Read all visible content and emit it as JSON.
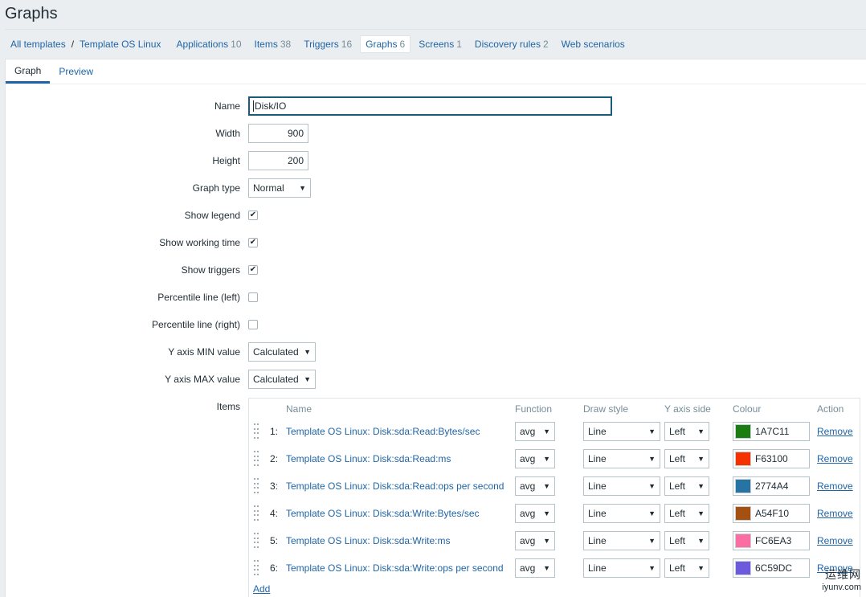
{
  "page": {
    "title": "Graphs"
  },
  "breadcrumbs": {
    "all_templates": "All templates",
    "separator": "/",
    "template": "Template OS Linux"
  },
  "tabs": [
    {
      "label": "Applications",
      "count": "10"
    },
    {
      "label": "Items",
      "count": "38"
    },
    {
      "label": "Triggers",
      "count": "16"
    },
    {
      "label": "Graphs",
      "count": "6",
      "active": true
    },
    {
      "label": "Screens",
      "count": "1"
    },
    {
      "label": "Discovery rules",
      "count": "2"
    },
    {
      "label": "Web scenarios",
      "count": ""
    }
  ],
  "subtabs": {
    "graph": "Graph",
    "preview": "Preview"
  },
  "form": {
    "name_label": "Name",
    "name_value": "Disk/IO",
    "width_label": "Width",
    "width_value": "900",
    "height_label": "Height",
    "height_value": "200",
    "graph_type_label": "Graph type",
    "graph_type_value": "Normal",
    "show_legend_label": "Show legend",
    "show_legend_checked": true,
    "show_working_time_label": "Show working time",
    "show_working_time_checked": true,
    "show_triggers_label": "Show triggers",
    "show_triggers_checked": true,
    "percentile_left_label": "Percentile line (left)",
    "percentile_left_checked": false,
    "percentile_right_label": "Percentile line (right)",
    "percentile_right_checked": false,
    "ymin_label": "Y axis MIN value",
    "ymin_value": "Calculated",
    "ymax_label": "Y axis MAX value",
    "ymax_value": "Calculated",
    "items_label": "Items"
  },
  "items_table": {
    "headers": {
      "name": "Name",
      "function": "Function",
      "draw_style": "Draw style",
      "y_axis_side": "Y axis side",
      "colour": "Colour",
      "action": "Action"
    },
    "rows": [
      {
        "num": "1:",
        "name": "Template OS Linux: Disk:sda:Read:Bytes/sec",
        "function": "avg",
        "draw_style": "Line",
        "y_axis_side": "Left",
        "colour": "1A7C11",
        "action": "Remove"
      },
      {
        "num": "2:",
        "name": "Template OS Linux: Disk:sda:Read:ms",
        "function": "avg",
        "draw_style": "Line",
        "y_axis_side": "Left",
        "colour": "F63100",
        "action": "Remove"
      },
      {
        "num": "3:",
        "name": "Template OS Linux: Disk:sda:Read:ops per second",
        "function": "avg",
        "draw_style": "Line",
        "y_axis_side": "Left",
        "colour": "2774A4",
        "action": "Remove"
      },
      {
        "num": "4:",
        "name": "Template OS Linux: Disk:sda:Write:Bytes/sec",
        "function": "avg",
        "draw_style": "Line",
        "y_axis_side": "Left",
        "colour": "A54F10",
        "action": "Remove"
      },
      {
        "num": "5:",
        "name": "Template OS Linux: Disk:sda:Write:ms",
        "function": "avg",
        "draw_style": "Line",
        "y_axis_side": "Left",
        "colour": "FC6EA3",
        "action": "Remove"
      },
      {
        "num": "6:",
        "name": "Template OS Linux: Disk:sda:Write:ops per second",
        "function": "avg",
        "draw_style": "Line",
        "y_axis_side": "Left",
        "colour": "6C59DC",
        "action": "Remove"
      }
    ],
    "add_label": "Add"
  },
  "watermark": {
    "top": "运维网",
    "bottom": "iyunv.com"
  },
  "icons": {
    "dropdown": "triangle-down-icon",
    "check": "checkmark-icon",
    "drag": "drag-handle-icon"
  }
}
